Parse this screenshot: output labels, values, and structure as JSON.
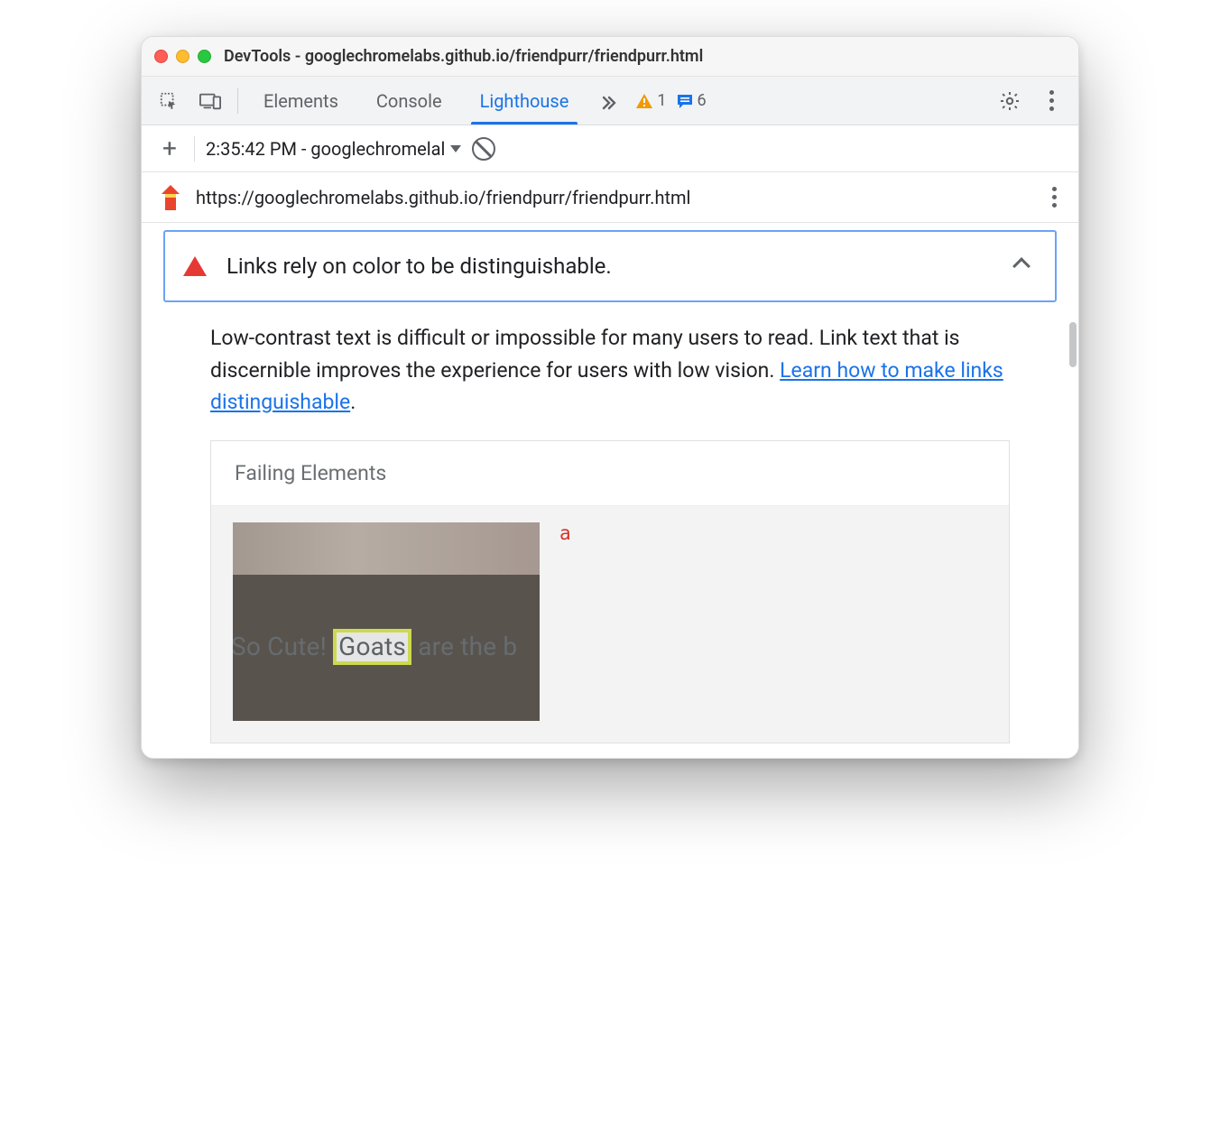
{
  "window": {
    "title": "DevTools - googlechromelabs.github.io/friendpurr/friendpurr.html"
  },
  "tabs": {
    "elements": "Elements",
    "console": "Console",
    "lighthouse": "Lighthouse"
  },
  "counts": {
    "warnings": "1",
    "messages": "6"
  },
  "report": {
    "selector": "2:35:42 PM - googlechromelal",
    "url": "https://googlechromelabs.github.io/friendpurr/friendpurr.html"
  },
  "audit": {
    "title": "Links rely on color to be distinguishable.",
    "description_pre": "Low-contrast text is difficult or impossible for many users to read. Link text that is discernible improves the experience for users with low vision. ",
    "learn_link": "Learn how to make links distinguishable",
    "description_post": "."
  },
  "failing": {
    "header": "Failing Elements",
    "tag": "a",
    "thumb_text_pre": "So Cute! ",
    "thumb_text_hl": "Goats",
    "thumb_text_post": " are the b"
  }
}
